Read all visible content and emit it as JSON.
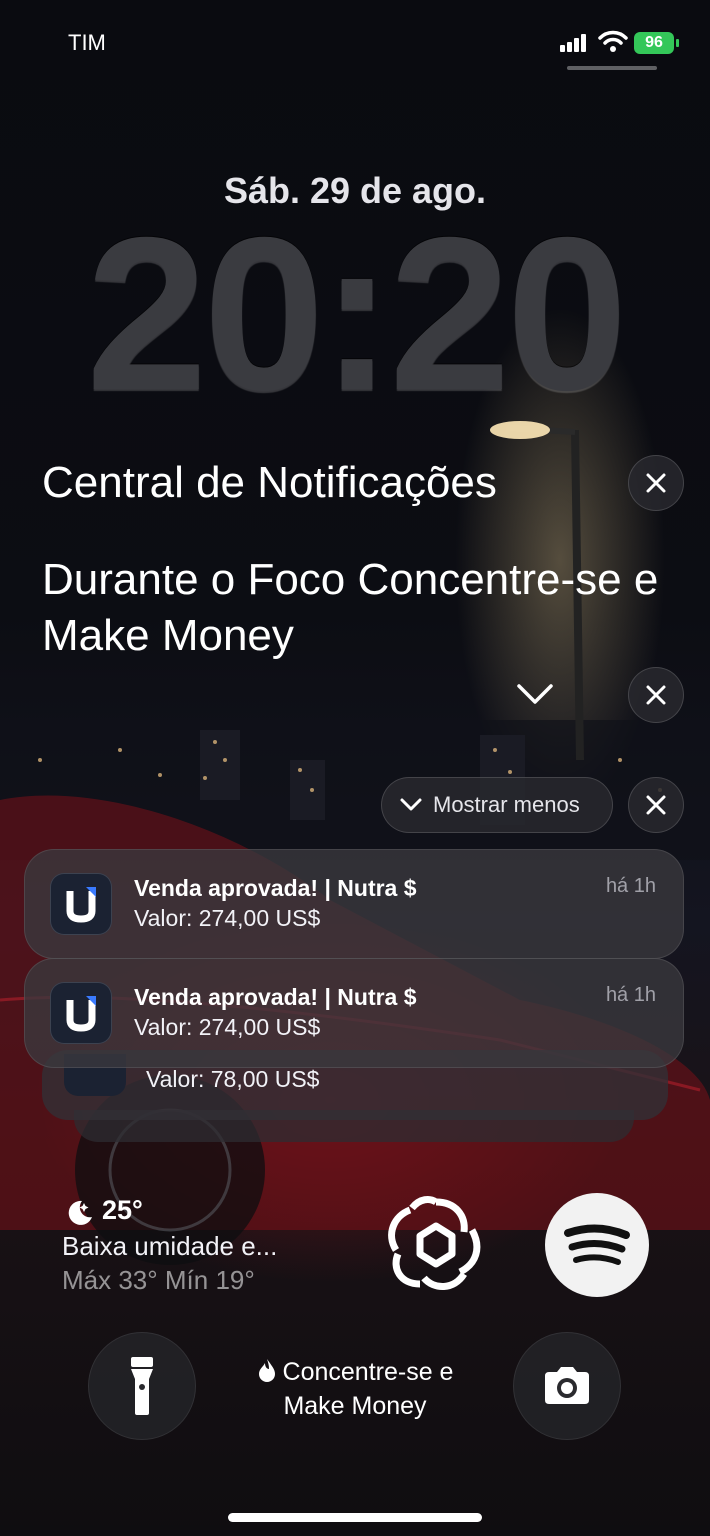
{
  "status_bar": {
    "carrier": "TIM",
    "battery": "96"
  },
  "lock": {
    "date": "Sáb. 29 de ago.",
    "time": "20:20"
  },
  "notification_center": {
    "title": "Central de Notificações",
    "focus_title": "Durante o Foco Concentre-se e Make Money",
    "show_less_label": "Mostrar menos"
  },
  "notifications": [
    {
      "title": "Venda aprovada! | Nutra $",
      "body": "Valor: 274,00 US$",
      "time": "há 1h"
    },
    {
      "title": "Venda aprovada! | Nutra $",
      "body": "Valor: 274,00 US$",
      "time": "há 1h"
    },
    {
      "body": "Valor: 78,00 US$"
    }
  ],
  "widgets": {
    "weather": {
      "temp": "25°",
      "condition": "Baixa umidade e...",
      "range": "Máx 33° Mín 19°"
    },
    "apps": [
      "chatgpt-icon",
      "spotify-icon"
    ]
  },
  "focus_indicator": {
    "line1": "Concentre-se e",
    "line2": "Make Money"
  },
  "colors": {
    "battery": "#34c759",
    "clock": "#3a3b40"
  }
}
